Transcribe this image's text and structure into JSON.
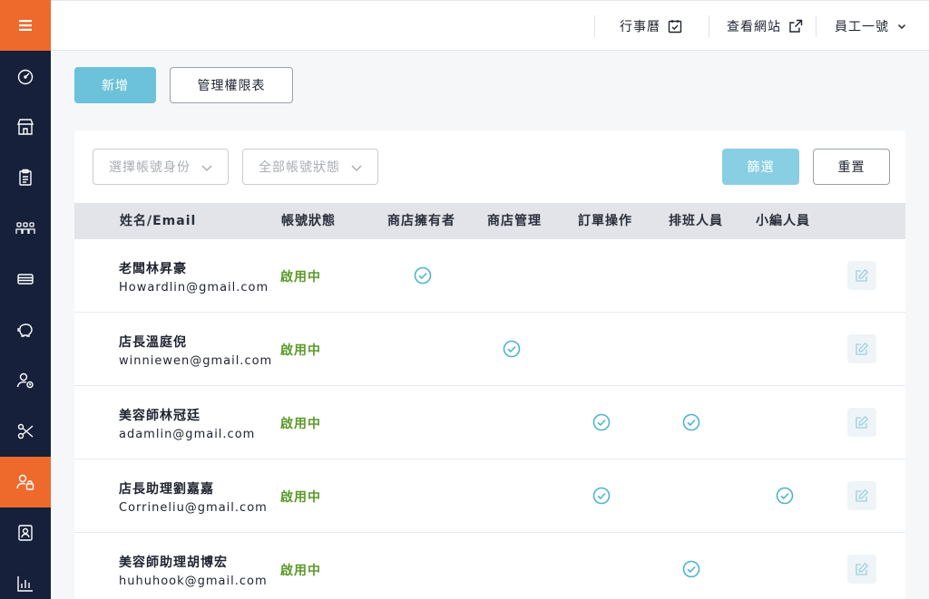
{
  "sidebar": {
    "menu_icon": "hamburger-icon",
    "items": [
      {
        "icon": "dashboard-icon",
        "active": false
      },
      {
        "icon": "store-icon",
        "active": false
      },
      {
        "icon": "clipboard-icon",
        "active": false
      },
      {
        "icon": "team-icon",
        "active": false
      },
      {
        "icon": "ticket-icon",
        "active": false
      },
      {
        "icon": "piggy-bank-icon",
        "active": false
      },
      {
        "icon": "user-settings-icon",
        "active": false
      },
      {
        "icon": "scissors-icon",
        "active": false
      },
      {
        "icon": "staff-icon",
        "active": true
      },
      {
        "icon": "contact-book-icon",
        "active": false
      },
      {
        "icon": "bar-chart-icon",
        "active": false
      }
    ]
  },
  "topbar": {
    "calendar_label": "行事曆",
    "view_site_label": "查看網站",
    "user_label": "員工一號"
  },
  "actions": {
    "add_label": "新增",
    "permissions_label": "管理權限表"
  },
  "filters": {
    "role_placeholder": "選擇帳號身份",
    "status_placeholder": "全部帳號狀態",
    "filter_label": "篩選",
    "reset_label": "重置"
  },
  "table": {
    "columns": [
      "姓名/Email",
      "帳號狀態",
      "商店擁有者",
      "商店管理",
      "訂單操作",
      "排班人員",
      "小編人員"
    ],
    "rows": [
      {
        "name": "老闆林昇豪",
        "email": "Howardlin@gmail.com",
        "status": "啟用中",
        "owner": true,
        "manager": false,
        "orders": false,
        "scheduler": false,
        "editor": false
      },
      {
        "name": "店長溫庭倪",
        "email": "winniewen@gmail.com",
        "status": "啟用中",
        "owner": false,
        "manager": true,
        "orders": false,
        "scheduler": false,
        "editor": false
      },
      {
        "name": "美容師林冠廷",
        "email": "adamlin@gmail.com",
        "status": "啟用中",
        "owner": false,
        "manager": false,
        "orders": true,
        "scheduler": true,
        "editor": false
      },
      {
        "name": "店長助理劉嘉嘉",
        "email": "Corrineliu@gmail.com",
        "status": "啟用中",
        "owner": false,
        "manager": false,
        "orders": true,
        "scheduler": false,
        "editor": true
      },
      {
        "name": "美容師助理胡博宏",
        "email": "huhuhook@gmail.com",
        "status": "啟用中",
        "owner": false,
        "manager": false,
        "orders": false,
        "scheduler": true,
        "editor": false
      }
    ]
  },
  "colors": {
    "accent": "#ee6a2c",
    "sidebar": "#16203a",
    "primary_button": "#6cc2da",
    "status_active": "#5a9a2a",
    "check": "#4fb3cf"
  }
}
